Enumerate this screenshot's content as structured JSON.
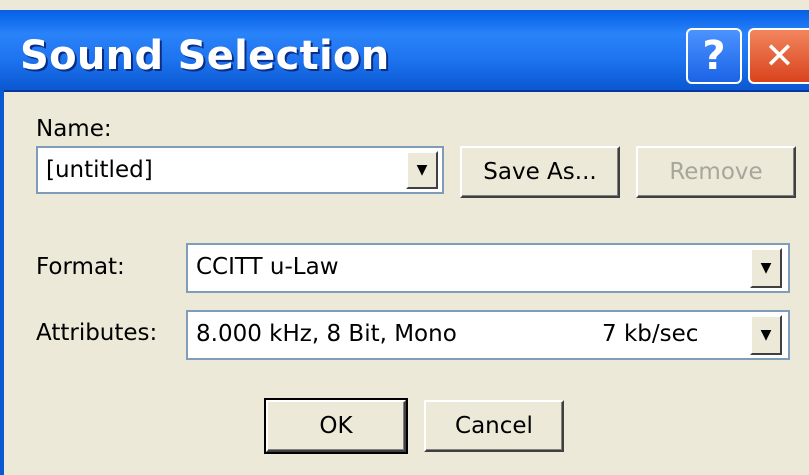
{
  "window": {
    "title": "Sound Selection",
    "help_glyph": "?",
    "close_glyph": "✕"
  },
  "name": {
    "label": "Name:",
    "value": "[untitled]"
  },
  "buttons": {
    "save_as": "Save As...",
    "remove": "Remove",
    "ok": "OK",
    "cancel": "Cancel"
  },
  "format": {
    "label": "Format:",
    "value": "CCITT u-Law"
  },
  "attributes": {
    "label": "Attributes:",
    "value": "8.000 kHz, 8 Bit, Mono",
    "rate": "7 kb/sec"
  },
  "icons": {
    "dropdown_arrow": "▼"
  },
  "colors": {
    "titlebar": "#0a5fe0",
    "face": "#ece9d8",
    "disabled_text": "#a7a69a"
  }
}
